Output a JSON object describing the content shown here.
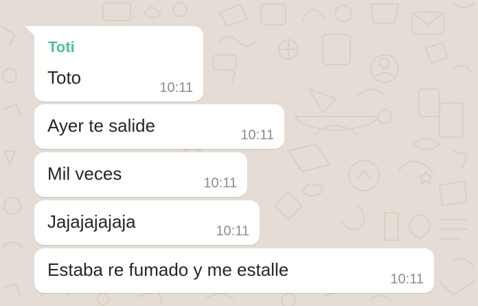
{
  "chat": {
    "background_color": "#e5ddd5",
    "bubble_color": "#ffffff",
    "sender_color": "#4fc28f",
    "messages": [
      {
        "sender": "Toti",
        "text": "Toto",
        "time": "10:11"
      },
      {
        "text": "Ayer te salide",
        "time": "10:11"
      },
      {
        "text": "Mil veces",
        "time": "10:11"
      },
      {
        "text": "Jajajajajaja",
        "time": "10:11"
      },
      {
        "text": "Estaba re fumado y me estalle",
        "time": "10:11"
      }
    ]
  }
}
